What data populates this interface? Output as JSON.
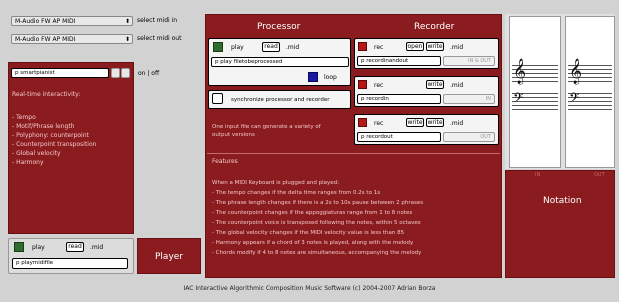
{
  "left": {
    "midi_in_device": "M-Audio FW AP MIDI",
    "midi_in_label": "select midi in",
    "midi_out_device": "M-Audio FW AP MIDI",
    "midi_out_label": "select midi out",
    "pianist_field": "p smartpianist",
    "on_off_label": "on | off",
    "interactivity_title": "Real-time interactivity:",
    "interactivity_items": [
      "- Tempo",
      "- Motif/Phrase length",
      "- Polyphony: counterpoint",
      "- Counterpoint transposition",
      "- Global velocity",
      "- Harmony"
    ]
  },
  "player": {
    "play_label": "play",
    "read_label": "read",
    "ext": ".mid",
    "field": "p playmidifile",
    "title": "Player"
  },
  "processor": {
    "title": "Processor",
    "play_label": "play",
    "read_label": "read",
    "ext": ".mid",
    "field": "p play filetobeprocessed",
    "loop_label": "loop",
    "sync_label": "synchronize processor and recorder",
    "note": "One input file can generate a variety of output versions"
  },
  "recorder": {
    "title": "Recorder",
    "rows": [
      {
        "rec": "rec",
        "btns": [
          "open",
          "write"
        ],
        "ext": ".mid",
        "field": "p recordinandout",
        "status": "IN & OUT"
      },
      {
        "rec": "rec",
        "btns": [
          "write"
        ],
        "ext": ".mid",
        "field": "p recordin",
        "status": "IN"
      },
      {
        "rec": "rec",
        "btns": [
          "write",
          "write"
        ],
        "ext": ".mid",
        "field": "p recordout",
        "status": "OUT"
      }
    ]
  },
  "features": {
    "title": "Features",
    "items": [
      "When a MIDI Keyboard is plugged and played:",
      "- The tempo changes if the delta time ranges from 0.2s to 1s",
      "- The phrase length changes if there is a 2s to 10s pause between 2 phrases",
      "- The counterpoint changes if the appoggiaturas range from 1 to 8 notes",
      "- The counterpoint voice is transposed following the notes, within 5 octaves",
      "- The global velocity changes if the MIDI velocity value is less than 85",
      "- Harmony appears if a chord of 3 notes is played, along with the melody",
      "- Chords modify if 4 to 8 notes are simultaneous, accompanying the melody"
    ]
  },
  "notation": {
    "in_label": "IN",
    "out_label": "OUT",
    "title": "Notation"
  },
  "footer": "IAC Interactive Algorithmic Composition Music Software (c) 2004-2007 Adrian Borza",
  "colors": {
    "panel": "#8a1b1e",
    "background": "#d2d2d2"
  }
}
